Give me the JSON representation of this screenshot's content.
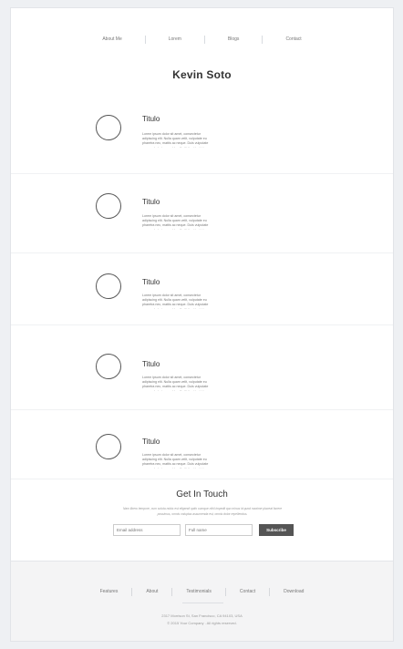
{
  "nav": [
    "About Me",
    "Lorem",
    "Blogs",
    "Contact"
  ],
  "site_title": "Kevin Soto",
  "entries": [
    {
      "title": "Titulo",
      "text": "Lorem ipsum dolor sit amet, consectetur adipiscing elit. Nulla quam velit, vulputate eu pharetra nec, mattis ac neque. Duis vulputate commodo lectus, ac blandit elit tincidunt id."
    },
    {
      "title": "Titulo",
      "text": "Lorem ipsum dolor sit amet, consectetur adipiscing elit. Nulla quam velit, vulputate eu pharetra nec, mattis ac neque. Duis vulputate commodo lectus, ac blandit elit tincidunt id."
    },
    {
      "title": "Titulo",
      "text": "Lorem ipsum dolor sit amet, consectetur adipiscing elit. Nulla quam velit, vulputate eu pharetra nec, mattis ac neque. Duis vulputate commodo lectus, ac blandit elit tincidunt id."
    },
    {
      "title": "Titulo",
      "text": "Lorem ipsum dolor sit amet, consectetur adipiscing elit. Nulla quam velit, vulputate eu pharetra nec, mattis ac neque. Duis vulputate commodo lectus, ac blandit elit tincidunt id."
    },
    {
      "title": "Titulo",
      "text": "Lorem ipsum dolor sit amet, consectetur adipiscing elit. Nulla quam velit, vulputate eu pharetra nec, mattis ac neque. Duis vulputate commodo lectus, ac blandit elit tincidunt id."
    }
  ],
  "get_in_touch": {
    "title": "Get In Touch",
    "text": "Nam libero tempore, cum soluta nobis est eligendi optio cumque nihil impedit quo minus id quod maxime placeat facere possimus, omnis voluptas assumenda est, omnis dolor repellendus.",
    "email_placeholder": "Email address",
    "name_placeholder": "Full name",
    "subscribe_label": "Subscribe"
  },
  "footer": {
    "nav": [
      "Features",
      "About",
      "Testimonials",
      "Contact",
      "Download"
    ],
    "address": "2317 Morrison St, San Francisco, CA 94103, USA",
    "copyright": "© 2015 Your Company . All rights reserved."
  }
}
